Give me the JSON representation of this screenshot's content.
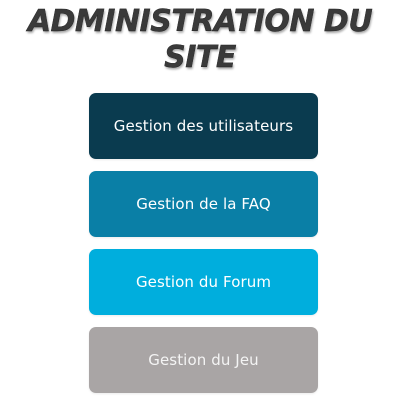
{
  "header": {
    "title_line1": "ADMINISTRATION DU",
    "title_line2": "SITE"
  },
  "menu": {
    "items": [
      {
        "label": "Gestion des utilisateurs",
        "color": "#0a3b4f"
      },
      {
        "label": "Gestion de la FAQ",
        "color": "#0a7fa6"
      },
      {
        "label": "Gestion du Forum",
        "color": "#00aedd"
      },
      {
        "label": "Gestion du Jeu",
        "color": "#a9a5a5"
      }
    ]
  }
}
